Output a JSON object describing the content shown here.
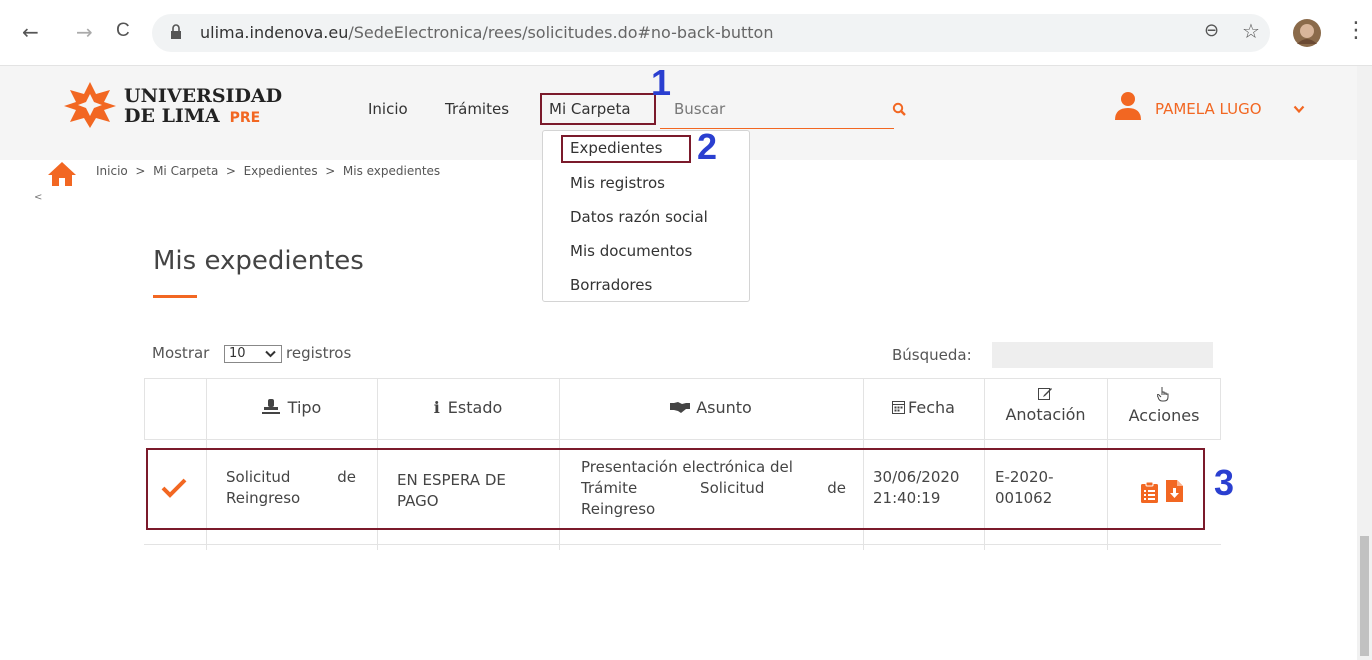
{
  "browser": {
    "url_domain": "ulima.indenova.eu",
    "url_path": "/SedeElectronica/rees/solicitudes.do#no-back-button",
    "back": "←",
    "forward": "→",
    "reload": "C",
    "zoom": "⊖",
    "star": "☆",
    "menu": "⋮"
  },
  "header": {
    "logo_line1": "UNIVERSIDAD",
    "logo_line2": "DE LIMA",
    "logo_badge": "PRE",
    "nav": [
      "Inicio",
      "Trámites",
      "Mi Carpeta"
    ],
    "search_placeholder": "Buscar",
    "user_name": "PAMELA LUGO"
  },
  "annotations": [
    "1",
    "2",
    "3"
  ],
  "dropdown": {
    "items": [
      "Expedientes",
      "Mis registros",
      "Datos razón social",
      "Mis documentos",
      "Borradores"
    ]
  },
  "breadcrumb": "Inicio  >  Mi Carpeta  >  Expedientes  >  Mis expedientes",
  "collapse_arrow": "<",
  "page_title": "Mis expedientes",
  "table_controls": {
    "show_label": "Mostrar",
    "show_value": "10",
    "records_label": "registros",
    "search_label": "Búsqueda:"
  },
  "table": {
    "headers": [
      "Tipo",
      "Estado",
      "Asunto",
      "Fecha",
      "Anotación",
      "Acciones"
    ],
    "row": {
      "tipo_1": "Solicitud",
      "tipo_de": "de",
      "tipo_2": "Reingreso",
      "estado_1": "EN ESPERA DE",
      "estado_2": "PAGO",
      "asunto_1": "Presentación electrónica del",
      "asunto_2a": "Trámite",
      "asunto_2b": "Solicitud",
      "asunto_2c": "de",
      "asunto_3": "Reingreso",
      "fecha_1": "30/06/2020",
      "fecha_2": "21:40:19",
      "anotacion_1": "E-2020-",
      "anotacion_2": "001062"
    }
  },
  "colors": {
    "accent": "#f26722",
    "annotation_box": "#7b1a2b",
    "annotation_number": "#2a3fd0"
  }
}
